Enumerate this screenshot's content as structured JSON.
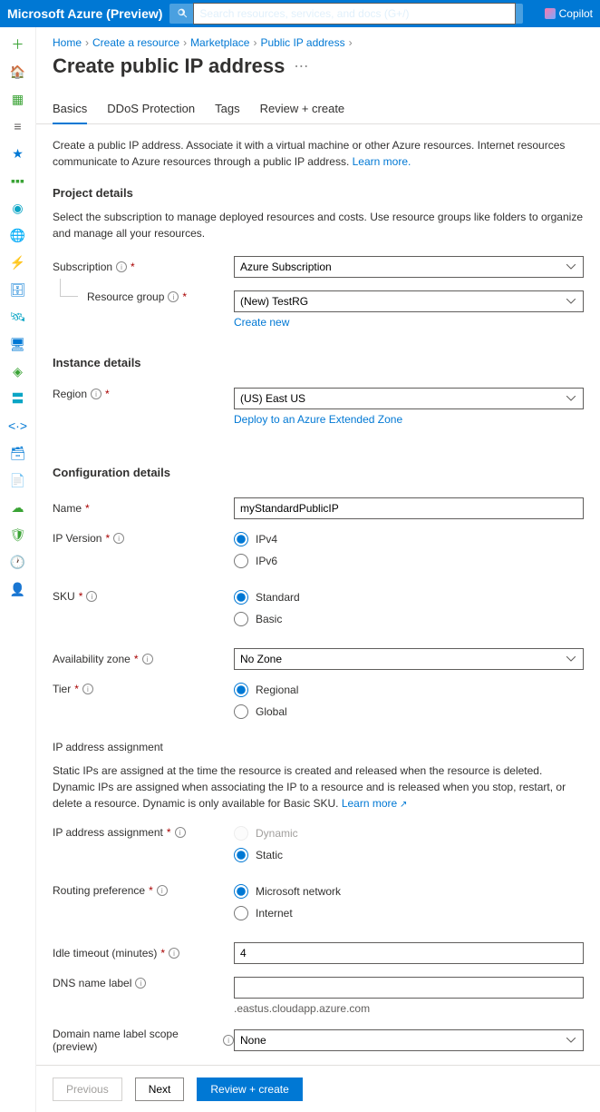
{
  "topbar": {
    "brand": "Microsoft Azure (Preview)",
    "search_placeholder": "Search resources, services, and docs (G+/)",
    "copilot": "Copilot"
  },
  "breadcrumbs": [
    "Home",
    "Create a resource",
    "Marketplace",
    "Public IP address"
  ],
  "page_title": "Create public IP address",
  "tabs": {
    "basics": "Basics",
    "ddos": "DDoS Protection",
    "tags": "Tags",
    "review": "Review + create"
  },
  "intro": {
    "text": "Create a public IP address. Associate it with a virtual machine or other Azure resources. Internet resources communicate to Azure resources through a public IP address. ",
    "link": "Learn more."
  },
  "project": {
    "heading": "Project details",
    "desc": "Select the subscription to manage deployed resources and costs. Use resource groups like folders to organize and manage all your resources.",
    "subscription_label": "Subscription",
    "subscription_value": "Azure Subscription",
    "rg_label": "Resource group",
    "rg_value": "(New) TestRG",
    "rg_create": "Create new"
  },
  "instance": {
    "heading": "Instance details",
    "region_label": "Region",
    "region_value": "(US) East US",
    "region_link": "Deploy to an Azure Extended Zone"
  },
  "config": {
    "heading": "Configuration details",
    "name_label": "Name",
    "name_value": "myStandardPublicIP",
    "ipver_label": "IP Version",
    "ipver_opts": [
      "IPv4",
      "IPv6"
    ],
    "sku_label": "SKU",
    "sku_opts": [
      "Standard",
      "Basic"
    ],
    "az_label": "Availability zone",
    "az_value": "No Zone",
    "tier_label": "Tier",
    "tier_opts": [
      "Regional",
      "Global"
    ]
  },
  "assign": {
    "heading": "IP address assignment",
    "desc_pre": "Static IPs are assigned at the time the resource is created and released when the resource is deleted. Dynamic IPs are assigned when associating the IP to a resource and is released when you stop, restart, or delete a resource. Dynamic is only available for Basic SKU. ",
    "desc_link": "Learn more",
    "label": "IP address assignment",
    "opts": [
      "Dynamic",
      "Static"
    ]
  },
  "routing": {
    "label": "Routing preference",
    "opts": [
      "Microsoft network",
      "Internet"
    ]
  },
  "idle": {
    "label": "Idle timeout (minutes)",
    "value": "4"
  },
  "dns": {
    "label": "DNS name label",
    "value": "",
    "suffix": ".eastus.cloudapp.azure.com"
  },
  "domain_scope": {
    "label": "Domain name label scope (preview)",
    "value": "None"
  },
  "footer": {
    "previous": "Previous",
    "next": "Next",
    "review": "Review + create"
  }
}
